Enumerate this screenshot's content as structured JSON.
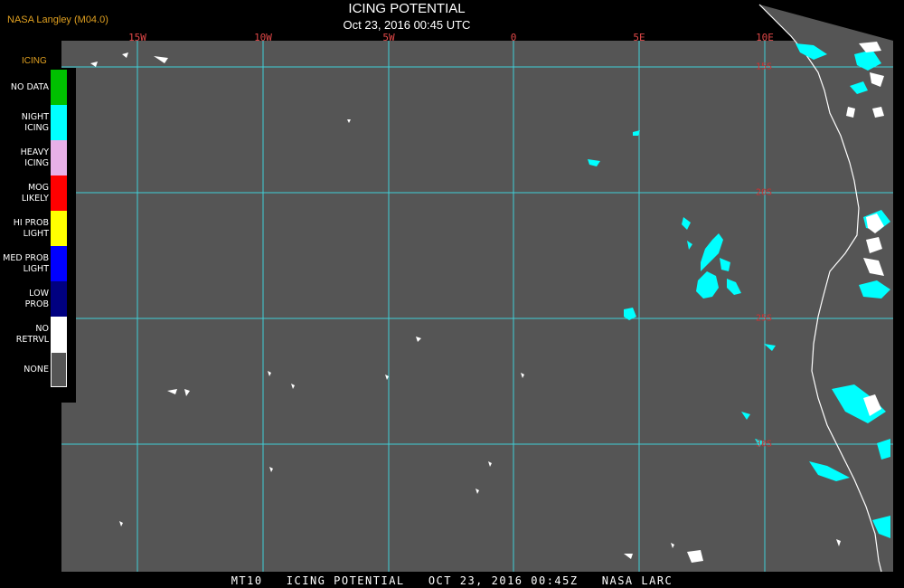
{
  "header": {
    "credit": "NASA Langley (M04.0)",
    "title": "ICING POTENTIAL",
    "subtitle": "Oct 23, 2016 00:45 UTC"
  },
  "longitude_labels": [
    "15W",
    "10W",
    "5W",
    "0",
    "5E",
    "10E"
  ],
  "latitude_labels": [
    "15S",
    "20S",
    "25S",
    "30S"
  ],
  "legend": {
    "title": "ICING",
    "items": [
      {
        "label": "NO DATA",
        "color": "#00c000"
      },
      {
        "label": "NIGHT\nICING",
        "color": "#00ffff"
      },
      {
        "label": "HEAVY\nICING",
        "color": "#e8b0e8"
      },
      {
        "label": "MOG\nLIKELY",
        "color": "#ff0000"
      },
      {
        "label": "HI PROB\nLIGHT",
        "color": "#ffff00"
      },
      {
        "label": "MED PROB\nLIGHT",
        "color": "#0000ff"
      },
      {
        "label": "LOW\nPROB",
        "color": "#000080"
      },
      {
        "label": "NO\nRETRVL",
        "color": "#ffffff"
      },
      {
        "label": "NONE",
        "color": "#555555"
      }
    ]
  },
  "footer": "MT10   ICING POTENTIAL   OCT 23, 2016 00:45Z   NASA LARC",
  "colors": {
    "ocean": "#555555",
    "grid": "#40d0d8",
    "coast": "#ffffff",
    "night_icing": "#00ffff",
    "no_retrieval": "#ffffff"
  }
}
